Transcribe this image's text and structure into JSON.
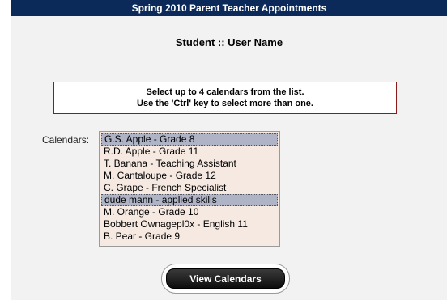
{
  "header": {
    "title": "Spring 2010 Parent Teacher Appointments"
  },
  "student": {
    "heading": "Student :: User Name"
  },
  "instructions": {
    "line1": "Select up to 4 calendars from the list.",
    "line2": "Use the 'Ctrl' key to select more than one."
  },
  "calendars": {
    "label": "Calendars:",
    "options": [
      {
        "label": "G.S. Apple - Grade 8",
        "selected": true
      },
      {
        "label": "R.D. Apple - Grade 11",
        "selected": false
      },
      {
        "label": "T. Banana - Teaching Assistant",
        "selected": false
      },
      {
        "label": "M. Cantaloupe - Grade 12",
        "selected": false
      },
      {
        "label": "C. Grape - French Specialist",
        "selected": false
      },
      {
        "label": "dude mann - applied skills",
        "selected": true
      },
      {
        "label": "M. Orange - Grade 10",
        "selected": false
      },
      {
        "label": "Bobbert Ownagepl0x - English 11",
        "selected": false
      },
      {
        "label": "B. Pear - Grade 9",
        "selected": false
      }
    ]
  },
  "actions": {
    "view_label": "View Calendars"
  },
  "colors": {
    "titlebar": "#0b2a5a",
    "listbox_bg": "#f6e9e2",
    "selected_bg": "#aeb3c6",
    "instructions_border": "#8b1a1a"
  }
}
